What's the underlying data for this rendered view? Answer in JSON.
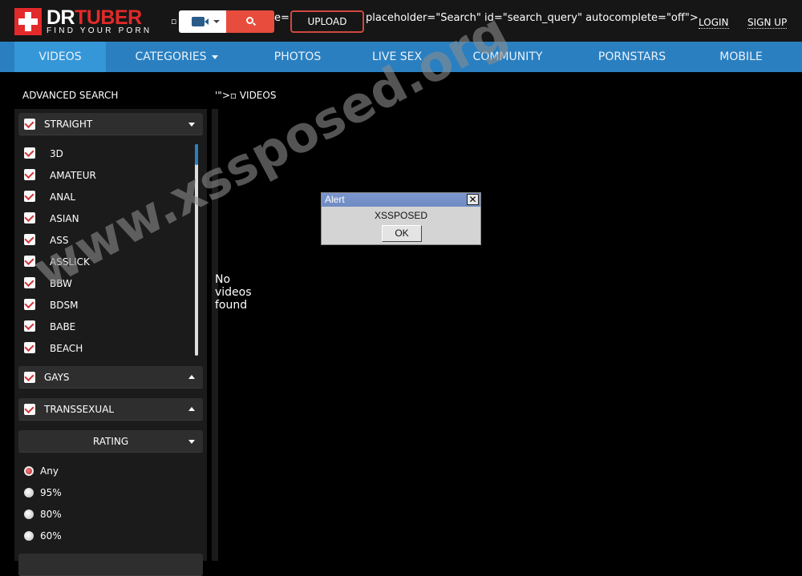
{
  "header": {
    "logo": {
      "part1": "DR",
      "part2": "TUBER",
      "tagline": "FIND YOUR PORN"
    },
    "broken_fragment_left": "▫",
    "broken_fragment_mid": "e=\"",
    "search_type_icon": "video-camera-icon",
    "search_button_icon": "search-icon",
    "upload_label": "UPLOAD",
    "raw_html_text": "placeholder=\"Search\" id=\"search_query\" autocomplete=\"off\">",
    "login_label": "LOGIN",
    "signup_label": "SIGN UP"
  },
  "nav": {
    "items": [
      {
        "label": "VIDEOS",
        "active": true
      },
      {
        "label": "CATEGORIES",
        "dropdown": true
      },
      {
        "label": "PHOTOS"
      },
      {
        "label": "LIVE SEX"
      },
      {
        "label": "COMMUNITY"
      },
      {
        "label": "PORNSTARS"
      },
      {
        "label": "MOBILE"
      }
    ]
  },
  "sidebar": {
    "title": "ADVANCED SEARCH",
    "sections": {
      "straight": {
        "label": "STRAIGHT",
        "checked": true,
        "expanded": true
      },
      "gays": {
        "label": "GAYS",
        "checked": true,
        "expanded": false
      },
      "transsexual": {
        "label": "TRANSSEXUAL",
        "checked": true,
        "expanded": false
      },
      "rating": {
        "label": "RATING",
        "expanded": true
      }
    },
    "categories": [
      {
        "label": "3D",
        "checked": true
      },
      {
        "label": "AMATEUR",
        "checked": true
      },
      {
        "label": "ANAL",
        "checked": true
      },
      {
        "label": "ASIAN",
        "checked": true
      },
      {
        "label": "ASS",
        "checked": true
      },
      {
        "label": "ASSLICK",
        "checked": true
      },
      {
        "label": "BBW",
        "checked": true
      },
      {
        "label": "BDSM",
        "checked": true
      },
      {
        "label": "BABE",
        "checked": true
      },
      {
        "label": "BEACH",
        "checked": true
      }
    ],
    "rating_options": [
      {
        "label": "Any",
        "selected": true
      },
      {
        "label": "95%",
        "selected": false
      },
      {
        "label": "80%",
        "selected": false
      },
      {
        "label": "60%",
        "selected": false
      }
    ]
  },
  "main": {
    "breadcrumb": "'\">▫ VIDEOS",
    "empty_message": "No videos found"
  },
  "alert": {
    "title": "Alert",
    "message": "XSSPOSED",
    "ok_label": "OK",
    "close_glyph": "✕"
  },
  "watermark": "www.xssposed.org",
  "colors": {
    "brand_red": "#e22a2a",
    "nav_blue": "#2a7fc0",
    "nav_active": "#3596d8",
    "search_red": "#e74c3c"
  }
}
